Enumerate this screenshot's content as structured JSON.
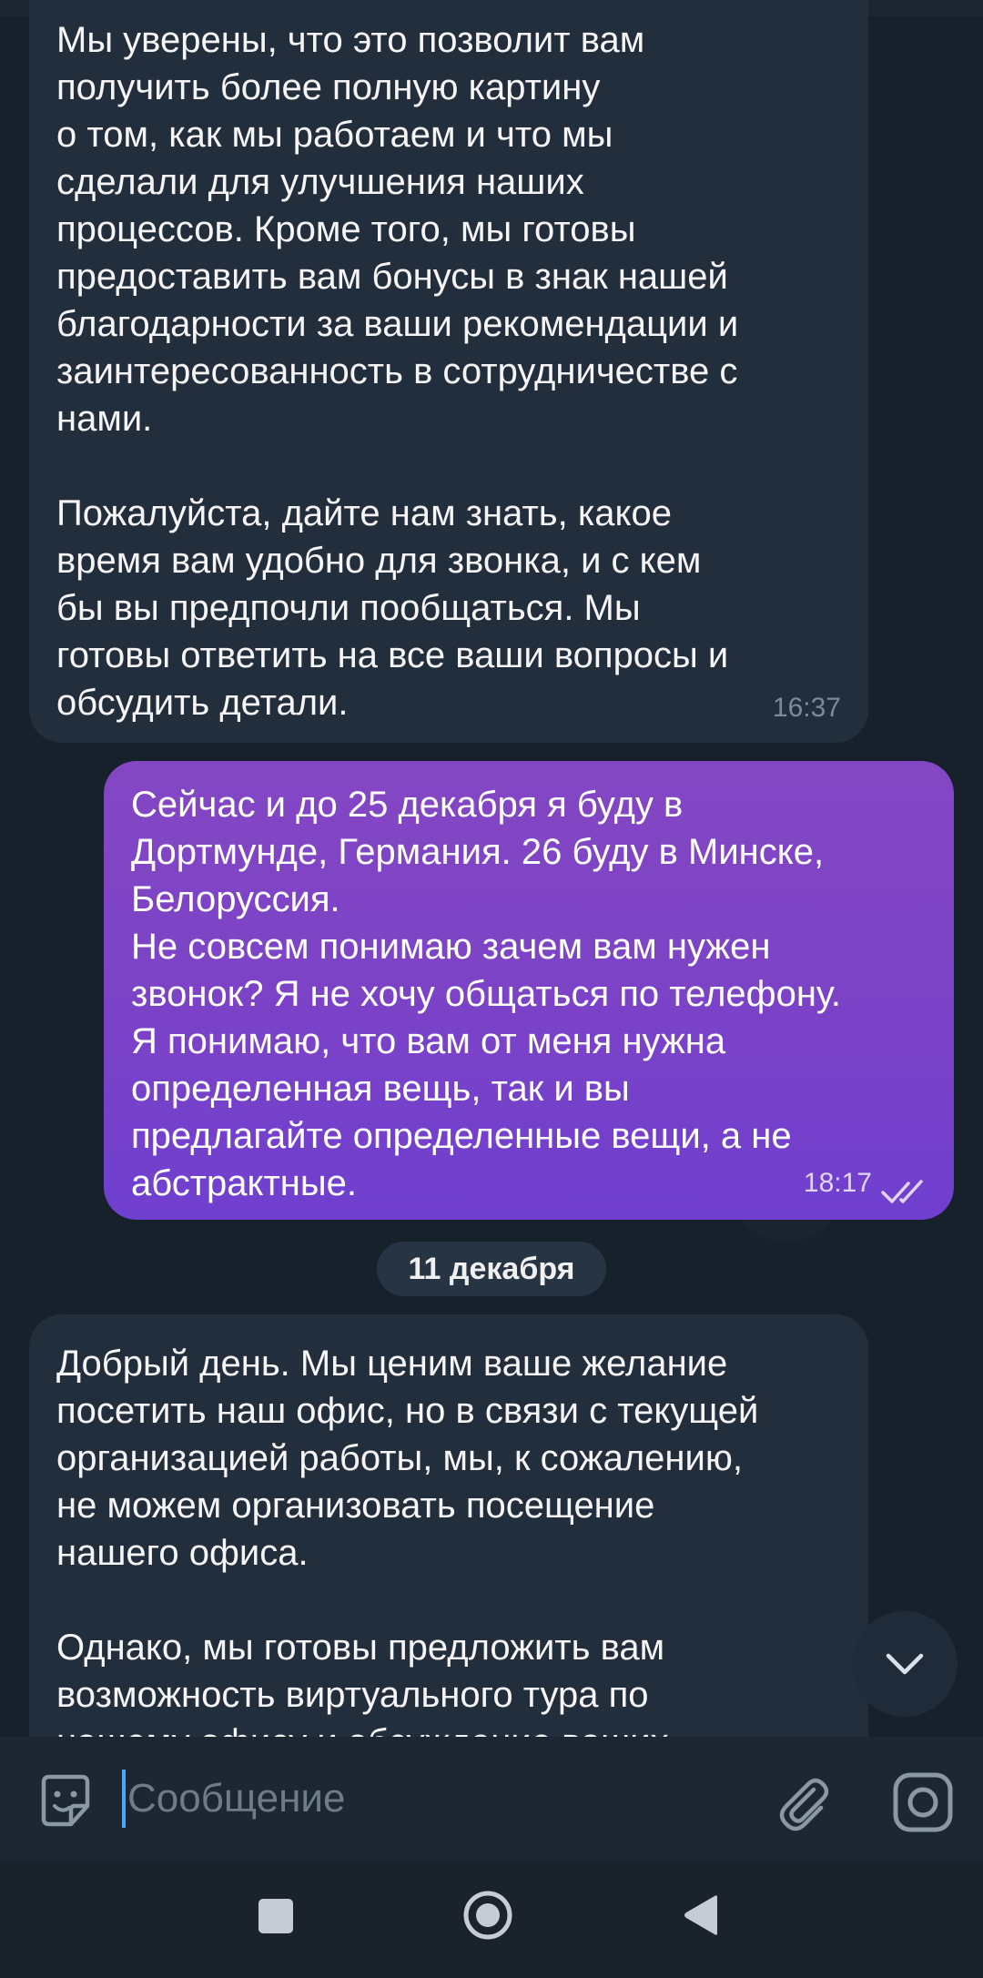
{
  "messages": {
    "incoming_1": {
      "text": "Мы уверены, что это позволит вам\nполучить более полную картину\nо том, как мы работаем и что мы\nсделали для улучшения наших\nпроцессов. Кроме того, мы готовы\nпредоставить вам бонусы в знак нашей\nблагодарности за ваши рекомендации и\nзаинтересованность в сотрудничестве с\nнами.\n\nПожалуйста, дайте нам знать, какое\nвремя вам удобно для звонка, и с кем\nбы вы предпочли пообщаться. Мы\nготовы ответить на все ваши вопросы и\nобсудить детали.",
      "time": "16:37"
    },
    "outgoing_1": {
      "text": "Сейчас и до 25 декабря я буду в\nДортмунде, Германия. 26 буду в Минске,\nБелоруссия.\nНе совсем понимаю зачем вам нужен\nзвонок? Я не хочу общаться по телефону.\nЯ понимаю, что вам от меня нужна\nопределенная вещь, так и вы\nпредлагайте определенные вещи, а не\nабстрактные.",
      "time": "18:17",
      "status": "read"
    },
    "date_separator": "11 декабря",
    "incoming_2": {
      "text": "Добрый день. Мы ценим ваше желание\nпосетить наш офис, но в связи с текущей\nорганизацией работы, мы, к сожалению,\nне можем организовать посещение\nнашего офиса.\n\nОднако, мы готовы предложить вам\nвозможность виртуального тура по\nнашему офису и обсуждение ваших"
    }
  },
  "composer": {
    "placeholder": "Сообщение"
  },
  "icons": {
    "emoji": "sticker-emoji-icon",
    "attach": "paperclip-icon",
    "camera": "instagram-camera-icon",
    "scroll_down": "chevron-down-icon",
    "read_status": "double-check-icon"
  },
  "colors": {
    "background": "#17212b",
    "incoming_bubble": "#232e3c",
    "outgoing_bubble": "#7a42c8",
    "accent": "#4ea4f6"
  }
}
